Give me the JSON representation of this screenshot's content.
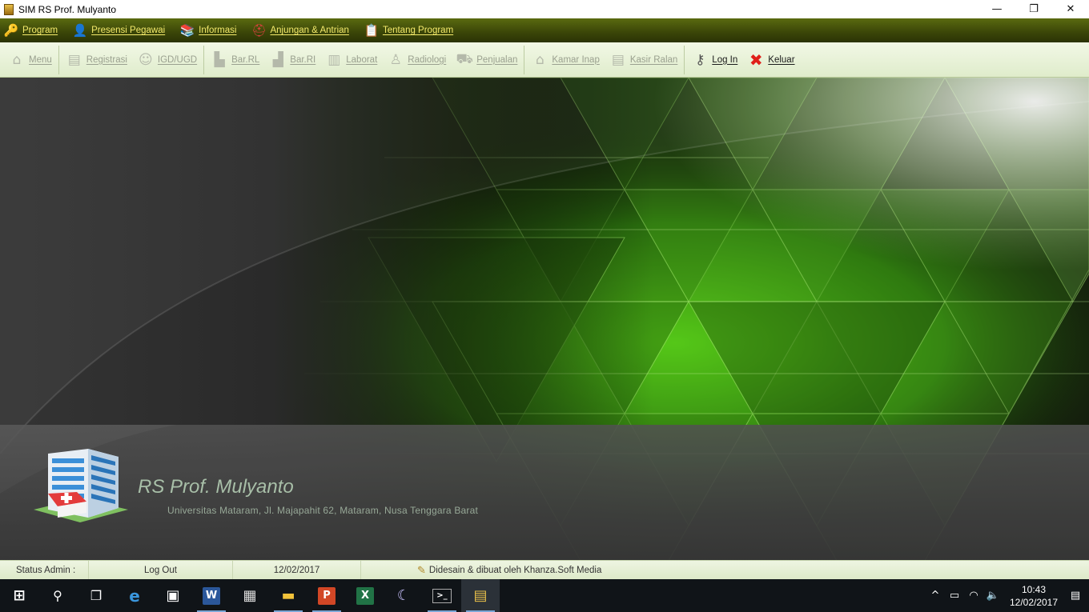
{
  "window": {
    "title": "SIM RS Prof. Mulyanto",
    "controls": {
      "minimize": "—",
      "restore": "❐",
      "close": "✕"
    }
  },
  "menubar": {
    "items": [
      {
        "label": "Program",
        "icon": "key-icon"
      },
      {
        "label": "Presensi Pegawai",
        "icon": "employee-icon"
      },
      {
        "label": "Informasi",
        "icon": "books-icon"
      },
      {
        "label": "Anjungan & Antrian",
        "icon": "lifebuoy-icon"
      },
      {
        "label": "Tentang Program",
        "icon": "clipboard-icon"
      }
    ]
  },
  "toolbar": {
    "items": [
      {
        "label": "Menu",
        "icon": "home-icon",
        "enabled": false
      },
      {
        "label": "Registrasi",
        "icon": "registration-icon",
        "enabled": false
      },
      {
        "label": "IGD/UGD",
        "icon": "patient-icon",
        "enabled": false
      },
      {
        "label": "Bar.RL",
        "icon": "stretcher-icon",
        "enabled": false
      },
      {
        "label": "Bar.RI",
        "icon": "bed-icon",
        "enabled": false
      },
      {
        "label": "Laborat",
        "icon": "lab-icon",
        "enabled": false
      },
      {
        "label": "Radiologi",
        "icon": "radiology-icon",
        "enabled": false
      },
      {
        "label": "Penjualan",
        "icon": "cart-icon",
        "enabled": false
      },
      {
        "label": "Kamar Inap",
        "icon": "ward-icon",
        "enabled": false
      },
      {
        "label": "Kasir Ralan",
        "icon": "cashier-icon",
        "enabled": false
      },
      {
        "label": "Log In",
        "icon": "login-keys-icon",
        "enabled": true
      },
      {
        "label": "Keluar",
        "icon": "exit-x-icon",
        "enabled": true
      }
    ]
  },
  "brand": {
    "name": "RS Prof. Mulyanto",
    "address": "Universitas Mataram, Jl. Majapahit 62, Mataram, Nusa Tenggara Barat"
  },
  "statusbar": {
    "admin": "Status Admin :",
    "logout": "Log Out",
    "date": "12/02/2017",
    "credit": "Didesain & dibuat oleh Khanza.Soft Media"
  },
  "taskbar": {
    "apps": [
      {
        "name": "start-icon",
        "glyph": "⊞"
      },
      {
        "name": "search-icon",
        "glyph": "⚲"
      },
      {
        "name": "task-view-icon",
        "glyph": "❐"
      },
      {
        "name": "edge-icon",
        "glyph": "e"
      },
      {
        "name": "store-icon",
        "glyph": "▣"
      },
      {
        "name": "word-icon",
        "glyph": "W"
      },
      {
        "name": "calculator-icon",
        "glyph": "▦"
      },
      {
        "name": "file-explorer-icon",
        "glyph": "▬"
      },
      {
        "name": "powerpoint-icon",
        "glyph": "P"
      },
      {
        "name": "excel-icon",
        "glyph": "X"
      },
      {
        "name": "app-moon-icon",
        "glyph": "☾"
      },
      {
        "name": "terminal-icon",
        "glyph": ">_"
      },
      {
        "name": "sim-rs-app-icon",
        "glyph": "▤"
      }
    ],
    "tray": {
      "chevron": "^",
      "battery": "▭",
      "wifi": "◠",
      "volume": "🔈",
      "time": "10:43",
      "date": "12/02/2017",
      "notifications": "▤"
    }
  },
  "colors": {
    "menubar_text": "#f4ea6b",
    "accent_green": "#5ec01e",
    "dark_bg": "#2e2e2e"
  }
}
